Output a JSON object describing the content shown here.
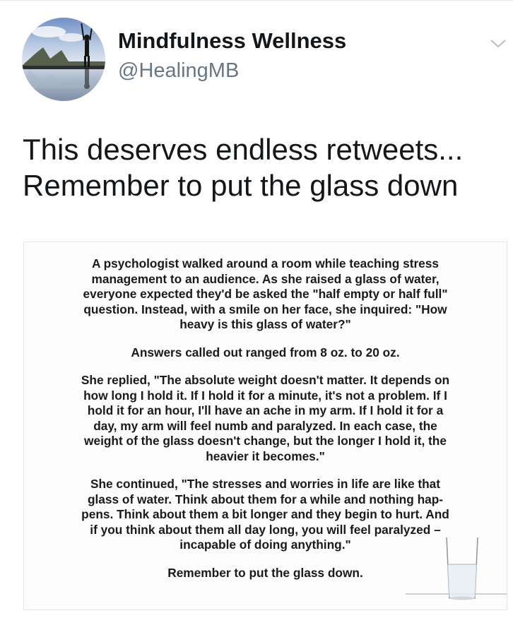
{
  "account": {
    "display_name": "Mindfulness Wellness",
    "handle": "@HealingMB"
  },
  "icons": {
    "avatar": "avatar-photo",
    "caret": "chevron-down-icon",
    "glass": "water-glass-illustration"
  },
  "colors": {
    "name": "#14171a",
    "handle": "#657786",
    "border": "#e1e8ed"
  },
  "tweet": {
    "lines": [
      "This deserves endless retweets...",
      "Remember to put the glass down"
    ]
  },
  "story": {
    "p1": [
      "A psychologist walked around a room while teaching stress",
      "management to an audience. As she raised a glass of water,",
      "everyone expected they'd be asked the \"half empty or half full\"",
      "question. Instead, with a smile on her face, she inquired: \"How",
      "heavy is this glass of water?\""
    ],
    "p2": [
      "Answers called out ranged from 8 oz. to 20 oz."
    ],
    "p3": [
      "She replied, \"The absolute weight doesn't matter. It depends on",
      "how long I hold it. If I hold it for a minute, it's not a problem. If I",
      "hold it for an hour, I'll have an ache in my arm. If I hold it for a",
      "day, my arm will feel numb and paralyzed. In each case, the",
      "weight of the glass doesn't change, but the longer I hold it, the",
      "heavier it becomes.\""
    ],
    "p4": [
      "She continued, \"The stresses and worries in life are like that",
      "glass of water. Think about them for a while and nothing hap-",
      "pens. Think about them a bit longer and they begin to hurt. And",
      "if you think about them all day long, you will feel paralyzed –",
      "incapable of doing anything.\""
    ],
    "p5": [
      "Remember to put the glass down."
    ]
  }
}
